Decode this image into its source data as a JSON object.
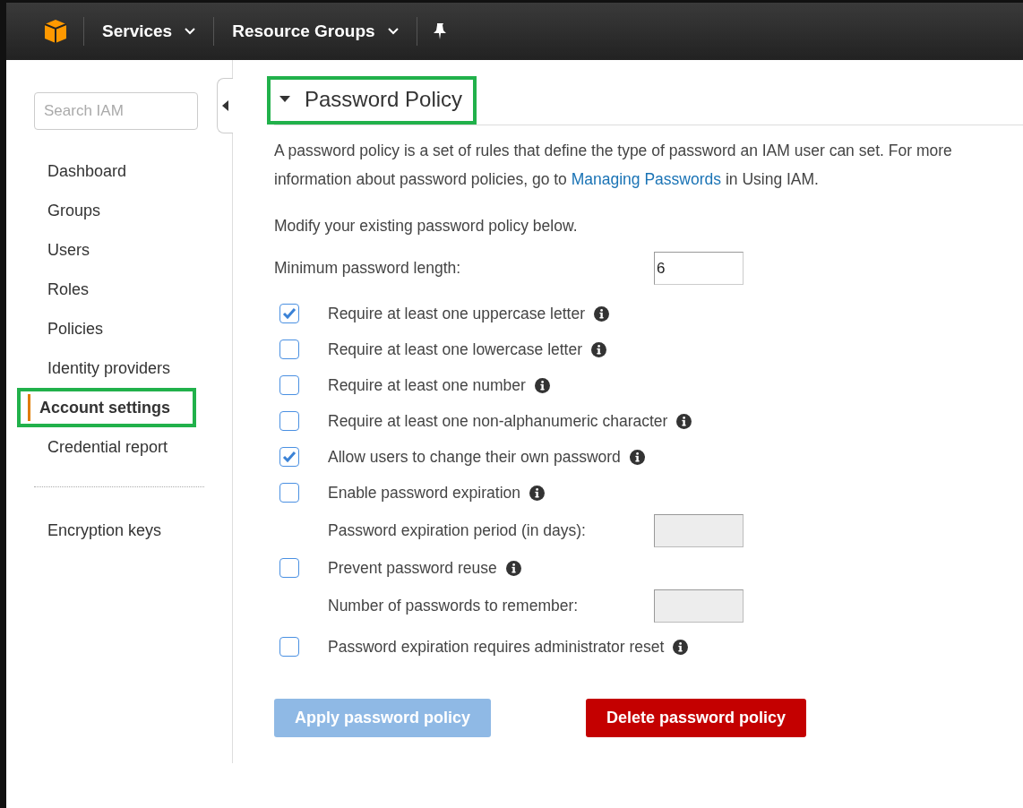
{
  "topbar": {
    "menus": [
      {
        "label": "Services"
      },
      {
        "label": "Resource Groups"
      }
    ]
  },
  "sidebar": {
    "search": {
      "placeholder": "Search IAM"
    },
    "items": [
      {
        "label": "Dashboard",
        "selected": false,
        "highlighted": false
      },
      {
        "label": "Groups",
        "selected": false,
        "highlighted": false
      },
      {
        "label": "Users",
        "selected": false,
        "highlighted": false
      },
      {
        "label": "Roles",
        "selected": false,
        "highlighted": false
      },
      {
        "label": "Policies",
        "selected": false,
        "highlighted": false
      },
      {
        "label": "Identity providers",
        "selected": false,
        "highlighted": false
      },
      {
        "label": "Account settings",
        "selected": true,
        "highlighted": true
      },
      {
        "label": "Credential report",
        "selected": false,
        "highlighted": false
      }
    ],
    "footer_items": [
      {
        "label": "Encryption keys",
        "selected": false
      }
    ]
  },
  "section": {
    "title": "Password Policy",
    "expanded": true,
    "highlighted": true,
    "intro_before": "A password policy is a set of rules that define the type of password an IAM user can set. For more information about password policies, go to ",
    "intro_link": "Managing Passwords",
    "intro_after": " in Using IAM.",
    "modify_note": "Modify your existing password policy below.",
    "min_length": {
      "label": "Minimum password length:",
      "value": "6"
    },
    "options": [
      {
        "kind": "checkbox",
        "label": "Require at least one uppercase letter",
        "checked": true
      },
      {
        "kind": "checkbox",
        "label": "Require at least one lowercase letter",
        "checked": false
      },
      {
        "kind": "checkbox",
        "label": "Require at least one number",
        "checked": false
      },
      {
        "kind": "checkbox",
        "label": "Require at least one non-alphanumeric character",
        "checked": false
      },
      {
        "kind": "checkbox",
        "label": "Allow users to change their own password",
        "checked": true
      },
      {
        "kind": "checkbox",
        "label": "Enable password expiration",
        "checked": false
      },
      {
        "kind": "number",
        "label": "Password expiration period (in days):",
        "disabled": true
      },
      {
        "kind": "checkbox",
        "label": "Prevent password reuse",
        "checked": false
      },
      {
        "kind": "number",
        "label": "Number of passwords to remember:",
        "disabled": true
      },
      {
        "kind": "checkbox",
        "label": "Password expiration requires administrator reset",
        "checked": false
      }
    ],
    "buttons": [
      {
        "kind": "primary",
        "label": "Apply password policy",
        "disabled": true
      },
      {
        "kind": "danger",
        "label": "Delete password policy",
        "disabled": false
      }
    ]
  }
}
